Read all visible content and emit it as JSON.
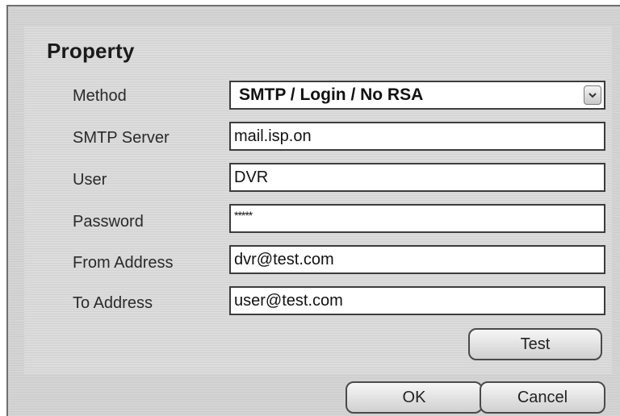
{
  "panel": {
    "title": "Property"
  },
  "fields": {
    "method": {
      "label": "Method",
      "value": "SMTP / Login / No RSA"
    },
    "smtp_server": {
      "label": "SMTP Server",
      "value": "mail.isp.on"
    },
    "user": {
      "label": "User",
      "value": "DVR"
    },
    "password": {
      "label": "Password",
      "value": "*****"
    },
    "from_address": {
      "label": "From Address",
      "value": "dvr@test.com"
    },
    "to_address": {
      "label": "To Address",
      "value": "user@test.com"
    }
  },
  "buttons": {
    "test": "Test",
    "ok": "OK",
    "cancel": "Cancel"
  },
  "icons": {
    "dropdown": "chevron-down-icon"
  },
  "colors": {
    "background": "#d3d3d3",
    "field_border": "#3c3c3c",
    "text": "#1a1a1a"
  }
}
